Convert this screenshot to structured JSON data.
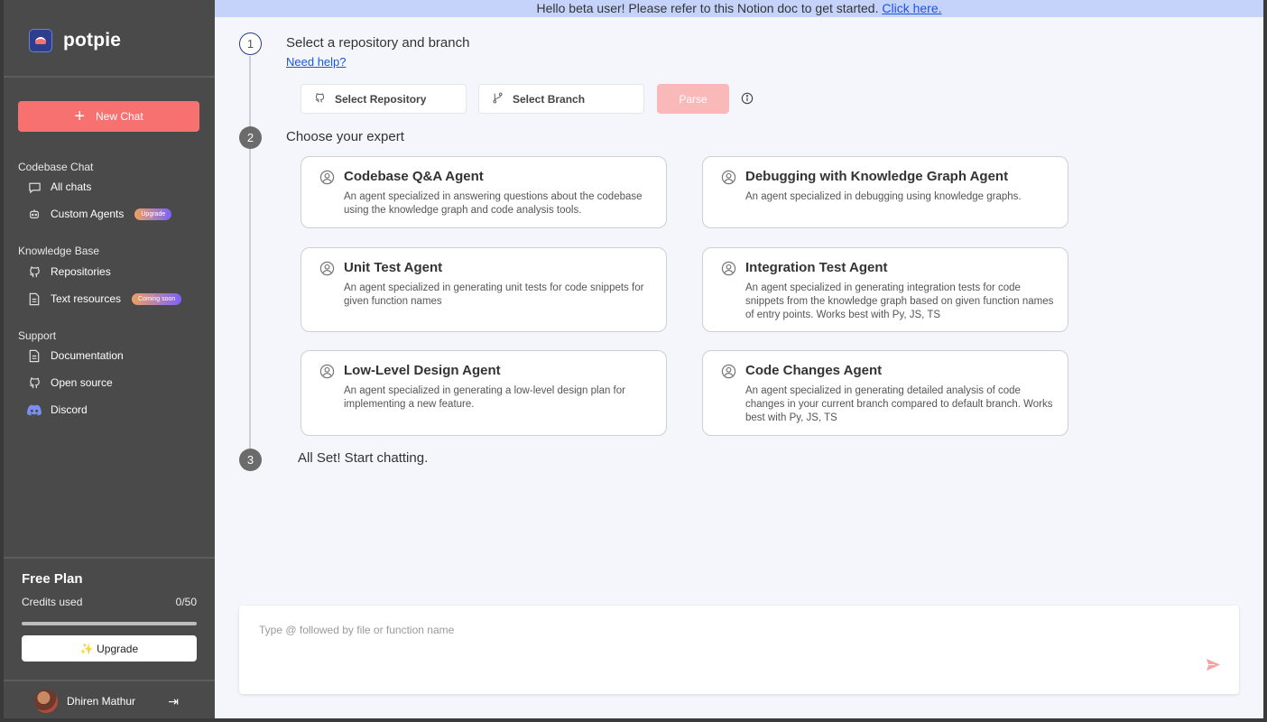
{
  "brand": {
    "name": "potpie"
  },
  "sidebar": {
    "new_chat_label": "New Chat",
    "sections": [
      {
        "label": "Codebase Chat"
      },
      {
        "label": "Knowledge Base"
      },
      {
        "label": "Support"
      }
    ],
    "items": [
      {
        "label": "All chats",
        "icon": "chat-bubble-icon"
      },
      {
        "label": "Custom Agents",
        "icon": "robot-icon",
        "badge": "Upgrade"
      },
      {
        "label": "Repositories",
        "icon": "github-icon"
      },
      {
        "label": "Text resources",
        "icon": "document-icon",
        "badge": "Coming soon"
      },
      {
        "label": "Documentation",
        "icon": "document-icon"
      },
      {
        "label": "Open source",
        "icon": "github-icon"
      },
      {
        "label": "Discord",
        "icon": "discord-icon"
      }
    ],
    "plan": {
      "title": "Free Plan",
      "credits_label": "Credits used",
      "credits_value": "0/50",
      "credits_fraction": 0,
      "upgrade_label": "✨ Upgrade"
    },
    "user": {
      "name": "Dhiren Mathur"
    }
  },
  "banner": {
    "text": "Hello beta user! Please refer to this Notion doc to get started.",
    "link": "Click here."
  },
  "steps": [
    {
      "number": "1",
      "title": "Select a repository and branch",
      "help": "Need help?"
    },
    {
      "number": "2",
      "title": "Choose your expert"
    },
    {
      "number": "3",
      "title": "All Set! Start chatting."
    }
  ],
  "selectors": {
    "repository_label": "Select Repository",
    "branch_label": "Select Branch",
    "parse_label": "Parse"
  },
  "agents": [
    {
      "name": "Codebase Q&A Agent",
      "desc": "An agent specialized in answering questions about the codebase using the knowledge graph and code analysis tools."
    },
    {
      "name": "Debugging with Knowledge Graph Agent",
      "desc": "An agent specialized in debugging using knowledge graphs."
    },
    {
      "name": "Unit Test Agent",
      "desc": "An agent specialized in generating unit tests for code snippets for given function names"
    },
    {
      "name": "Integration Test Agent",
      "desc": "An agent specialized in generating integration tests for code snippets from the knowledge graph based on given function names of entry points. Works best with Py, JS, TS"
    },
    {
      "name": "Low-Level Design Agent",
      "desc": "An agent specialized in generating a low-level design plan for implementing a new feature."
    },
    {
      "name": "Code Changes Agent",
      "desc": "An agent specialized in generating detailed analysis of code changes in your current branch compared to default branch. Works best with Py, JS, TS"
    }
  ],
  "chat": {
    "placeholder": "Type @ followed by file or function name"
  },
  "colors": {
    "accent": "#f87171",
    "link": "#1a56db",
    "banner": "#c5d3fb",
    "sidebar": "#4a4a4a"
  }
}
